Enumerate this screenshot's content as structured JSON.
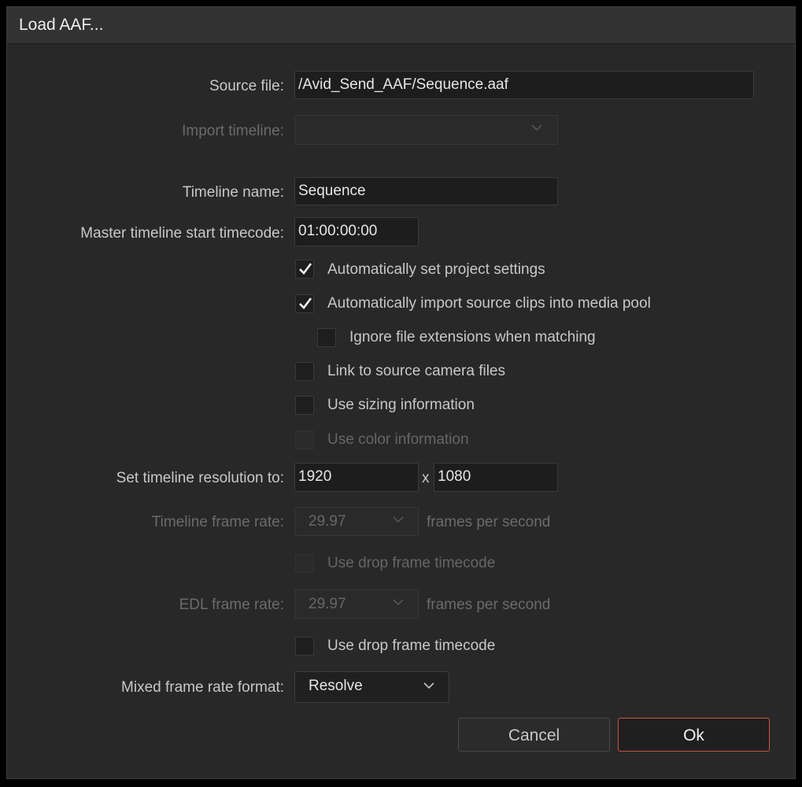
{
  "window": {
    "title": "Load AAF..."
  },
  "form": {
    "source_file": {
      "label": "Source file:",
      "value": "/Avid_Send_AAF/Sequence.aaf"
    },
    "import_timeline": {
      "label": "Import timeline:",
      "value": ""
    },
    "timeline_name": {
      "label": "Timeline name:",
      "value": "Sequence"
    },
    "start_timecode": {
      "label": "Master timeline start timecode:",
      "value": "01:00:00:00"
    },
    "checkboxes": {
      "auto_project_settings": {
        "label": "Automatically set project settings",
        "checked": true,
        "enabled": true
      },
      "auto_import_clips": {
        "label": "Automatically import source clips into media pool",
        "checked": true,
        "enabled": true
      },
      "ignore_extensions": {
        "label": "Ignore file extensions when matching",
        "checked": false,
        "enabled": true
      },
      "link_camera_files": {
        "label": "Link to source camera files",
        "checked": false,
        "enabled": true
      },
      "use_sizing": {
        "label": "Use sizing information",
        "checked": false,
        "enabled": true
      },
      "use_color": {
        "label": "Use color information",
        "checked": false,
        "enabled": false
      },
      "drop_frame_1": {
        "label": "Use drop frame timecode",
        "checked": false,
        "enabled": false
      },
      "drop_frame_2": {
        "label": "Use drop frame timecode",
        "checked": false,
        "enabled": true
      }
    },
    "resolution": {
      "label": "Set timeline resolution to:",
      "width": "1920",
      "separator": "x",
      "height": "1080"
    },
    "timeline_frame_rate": {
      "label": "Timeline frame rate:",
      "value": "29.97",
      "unit": "frames per second",
      "enabled": false
    },
    "edl_frame_rate": {
      "label": "EDL frame rate:",
      "value": "29.97",
      "unit": "frames per second",
      "enabled": false
    },
    "mixed_frame_rate": {
      "label": "Mixed frame rate format:",
      "value": "Resolve"
    }
  },
  "buttons": {
    "cancel": "Cancel",
    "ok": "Ok"
  },
  "colors": {
    "ok_border": "#c8523f",
    "dialog_bg": "#282828"
  }
}
